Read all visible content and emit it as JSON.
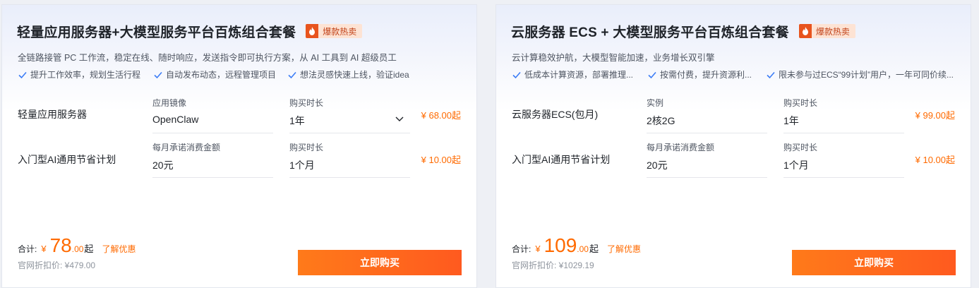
{
  "cards": [
    {
      "title": "轻量应用服务器+大模型服务平台百炼组合套餐",
      "badge": "爆款热卖",
      "subtitle": "全链路接管 PC 工作流，稳定在线、随时响应，发送指令即可执行方案，从 AI 工具到 AI 超级员工",
      "features": [
        "提升工作效率，规划生活行程",
        "自动发布动态，远程管理项目",
        "想法灵感快速上线，验证idea"
      ],
      "rows": [
        {
          "label": "轻量应用服务器",
          "field1": {
            "label": "应用镜像",
            "value": "OpenClaw"
          },
          "field2": {
            "label": "购买时长",
            "value": "1年"
          },
          "price": "¥ 68.00起"
        },
        {
          "label": "入门型AI通用节省计划",
          "field1": {
            "label": "每月承诺消费金额",
            "value": "20元"
          },
          "field2": {
            "label": "购买时长",
            "value": "1个月"
          },
          "price": "¥ 10.00起"
        }
      ],
      "total": {
        "label": "合计:",
        "yen": "¥",
        "int": "78",
        "dec": ".00",
        "suffix": "起",
        "link": "了解优惠"
      },
      "official": "官网折扣价: ¥479.00",
      "button": "立即购买"
    },
    {
      "title": "云服务器 ECS + 大模型服务平台百炼组合套餐",
      "badge": "爆款热卖",
      "subtitle": "云计算稳效护航，大模型智能加速，业务增长双引擎",
      "features": [
        "低成本计算资源，部署推理...",
        "按需付费，提升资源利...",
        "限未参与过ECS“99计划”用户，一年可同价续..."
      ],
      "rows": [
        {
          "label": "云服务器ECS(包月)",
          "field1": {
            "label": "实例",
            "value": "2核2G"
          },
          "field2": {
            "label": "购买时长",
            "value": "1年"
          },
          "price": "¥ 99.00起"
        },
        {
          "label": "入门型AI通用节省计划",
          "field1": {
            "label": "每月承诺消费金额",
            "value": "20元"
          },
          "field2": {
            "label": "购买时长",
            "value": "1个月"
          },
          "price": "¥ 10.00起"
        }
      ],
      "total": {
        "label": "合计:",
        "yen": "¥",
        "int": "109",
        "dec": ".00",
        "suffix": "起",
        "link": "了解优惠"
      },
      "official": "官网折扣价: ¥1029.19",
      "button": "立即购买"
    }
  ]
}
